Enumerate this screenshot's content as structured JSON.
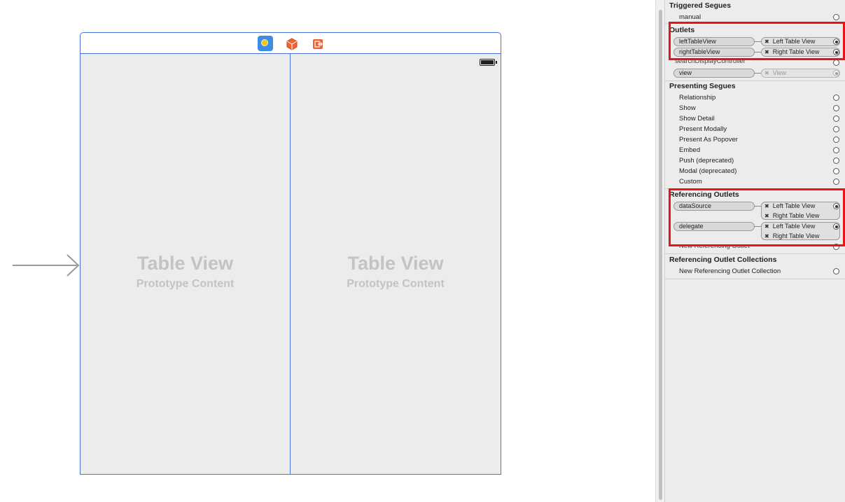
{
  "canvas": {
    "toolbar_icons": [
      "view-controller-icon",
      "first-responder-cube-icon",
      "exit-icon"
    ],
    "left_table": {
      "title": "Table View",
      "subtitle": "Prototype Content"
    },
    "right_table": {
      "title": "Table View",
      "subtitle": "Prototype Content"
    }
  },
  "inspector": {
    "triggered_segues": {
      "title": "Triggered Segues",
      "items": [
        {
          "label": "manual"
        }
      ]
    },
    "outlets": {
      "title": "Outlets",
      "connections": [
        {
          "name": "leftTableView",
          "target": "Left Table View"
        },
        {
          "name": "rightTableView",
          "target": "Right Table View"
        }
      ],
      "obscured_label": "searchDisplayController",
      "view_connection": {
        "name": "view",
        "target": "View"
      }
    },
    "presenting_segues": {
      "title": "Presenting Segues",
      "items": [
        {
          "label": "Relationship"
        },
        {
          "label": "Show"
        },
        {
          "label": "Show Detail"
        },
        {
          "label": "Present Modally"
        },
        {
          "label": "Present As Popover"
        },
        {
          "label": "Embed"
        },
        {
          "label": "Push (deprecated)"
        },
        {
          "label": "Modal (deprecated)"
        },
        {
          "label": "Custom"
        }
      ]
    },
    "referencing_outlets": {
      "title": "Referencing Outlets",
      "connections": [
        {
          "name": "dataSource",
          "targets": [
            "Left Table View",
            "Right Table View"
          ]
        },
        {
          "name": "delegate",
          "targets": [
            "Left Table View",
            "Right Table View"
          ]
        }
      ],
      "new_label": "New Referencing Outlet"
    },
    "referencing_collections": {
      "title": "Referencing Outlet Collections",
      "new_label": "New Referencing Outlet Collection"
    },
    "connection_remove_glyph": "✖"
  },
  "colors": {
    "selection_blue": "#4a74d9",
    "highlight_red": "#e8131b"
  }
}
